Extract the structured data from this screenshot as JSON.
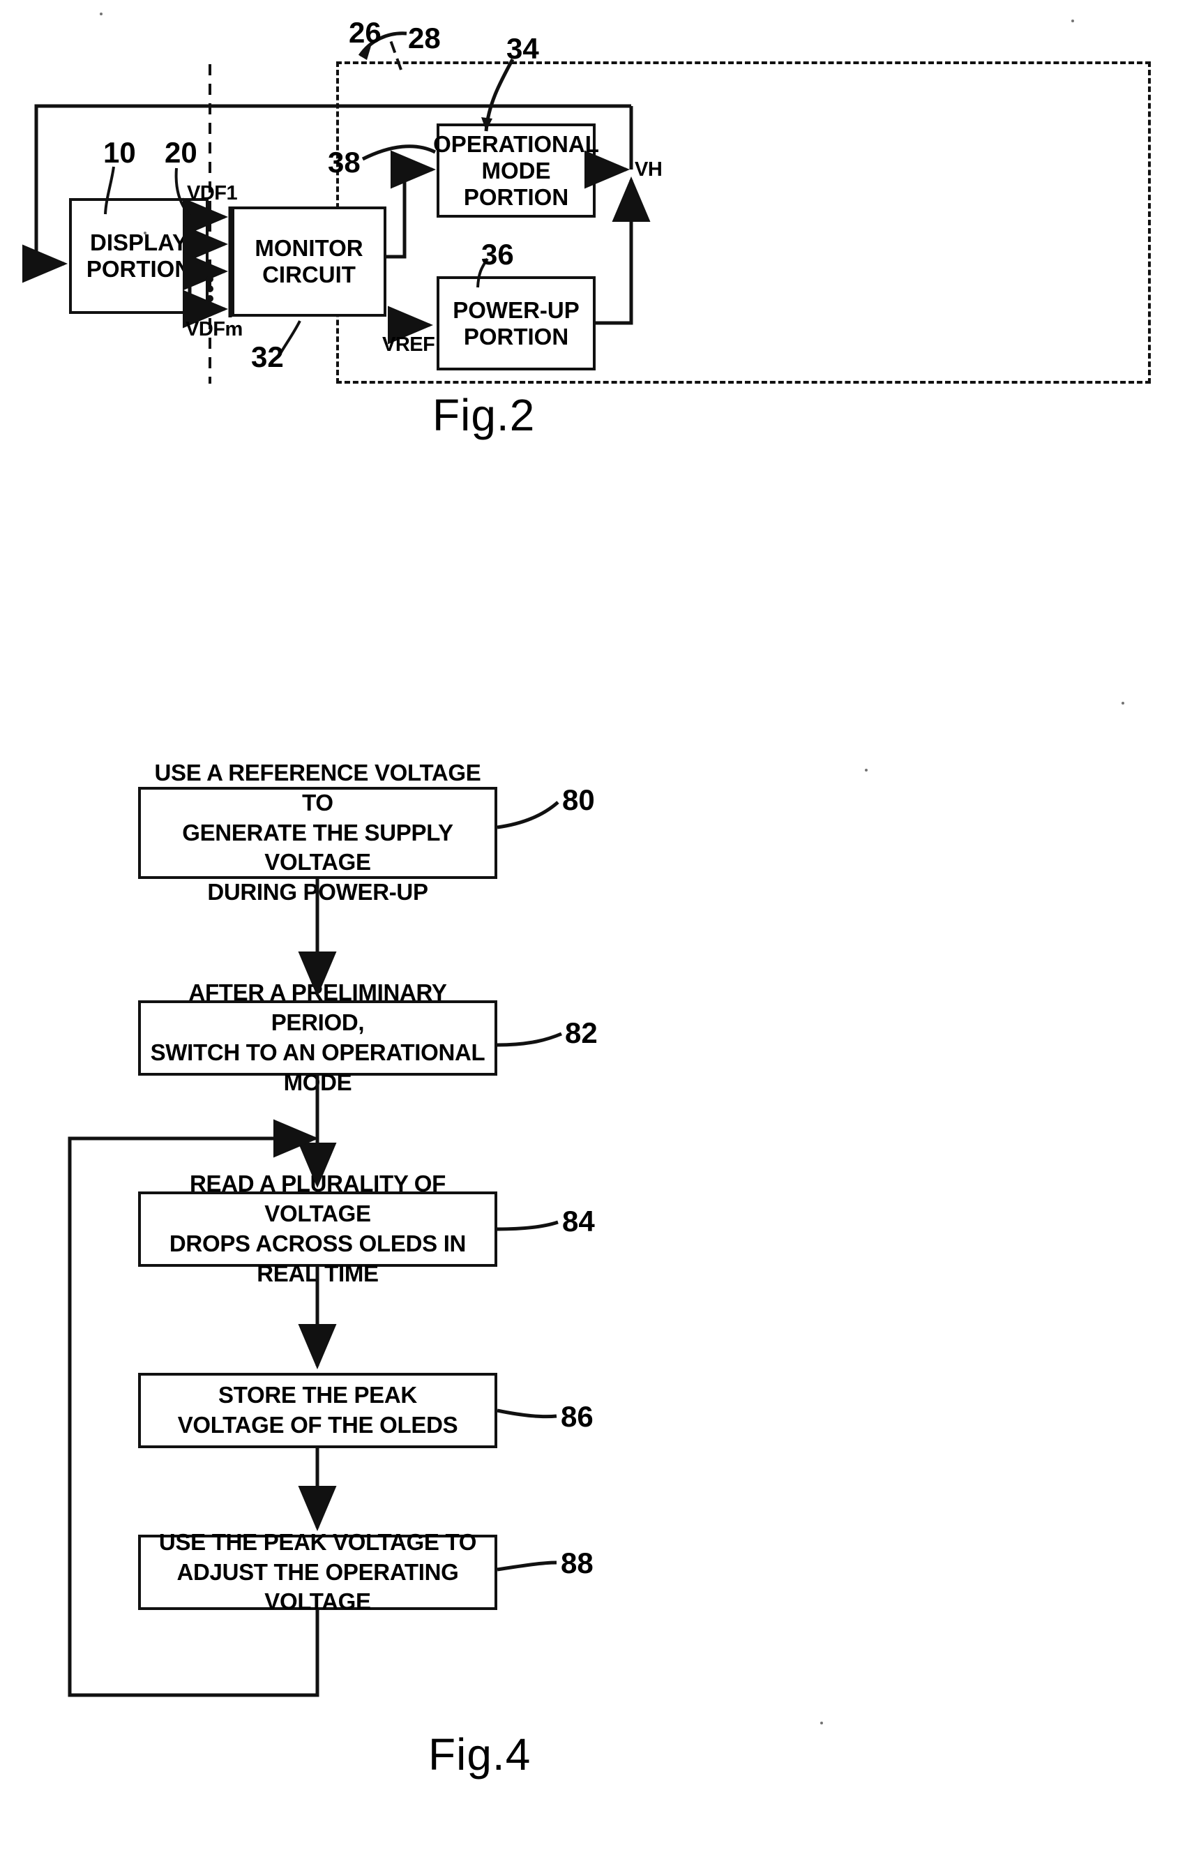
{
  "document": {
    "type": "patent-drawing-sheet",
    "figures": [
      {
        "id": "fig2",
        "caption": "Fig.2",
        "kind": "block-diagram"
      },
      {
        "id": "fig4",
        "caption": "Fig.4",
        "kind": "flowchart"
      }
    ]
  },
  "fig2": {
    "caption": "Fig.2",
    "blocks": [
      {
        "key": "display",
        "label_line1": "DISPLAY",
        "label_line2": "PORTION",
        "ref": "10"
      },
      {
        "key": "monitor",
        "label_line1": "MONITOR",
        "label_line2": "CIRCUIT",
        "ref": "32"
      },
      {
        "key": "operational",
        "label_line1": "OPERATIONAL",
        "label_line2": "MODE",
        "label_line3": "PORTION",
        "ref": "34"
      },
      {
        "key": "powerup",
        "label_line1": "POWER-UP",
        "label_line2": "PORTION",
        "ref": "36"
      }
    ],
    "refs": {
      "assembly": "26",
      "dashed_boundary": "28",
      "operational_mode_portion": "34",
      "power_up_portion": "36",
      "operational_mode_input": "38",
      "monitor_circuit": "32",
      "display_portion": "10",
      "feedback_bus": "20"
    },
    "signals": {
      "vdf_first": "VDF1",
      "vdf_last": "VDFm",
      "vref": "VREF",
      "vh": "VH"
    },
    "bus_arrow_count": 4
  },
  "fig4": {
    "caption": "Fig.4",
    "steps": [
      {
        "ref": "80",
        "lines": [
          "USE A REFERENCE VOLTAGE TO",
          "GENERATE THE SUPPLY VOLTAGE",
          "DURING POWER-UP"
        ]
      },
      {
        "ref": "82",
        "lines": [
          "AFTER A PRELIMINARY PERIOD,",
          "SWITCH TO AN OPERATIONAL MODE"
        ]
      },
      {
        "ref": "84",
        "lines": [
          "READ A PLURALITY OF VOLTAGE",
          "DROPS ACROSS OLEDS IN REAL TIME"
        ]
      },
      {
        "ref": "86",
        "lines": [
          "STORE THE PEAK",
          "VOLTAGE OF THE OLEDS"
        ]
      },
      {
        "ref": "88",
        "lines": [
          "USE THE PEAK VOLTAGE TO",
          "ADJUST THE OPERATING VOLTAGE"
        ]
      }
    ],
    "loop": {
      "from_step_ref": "88",
      "to_step_ref": "84"
    }
  },
  "colors": {
    "ink": "#111111",
    "paper": "#ffffff"
  }
}
